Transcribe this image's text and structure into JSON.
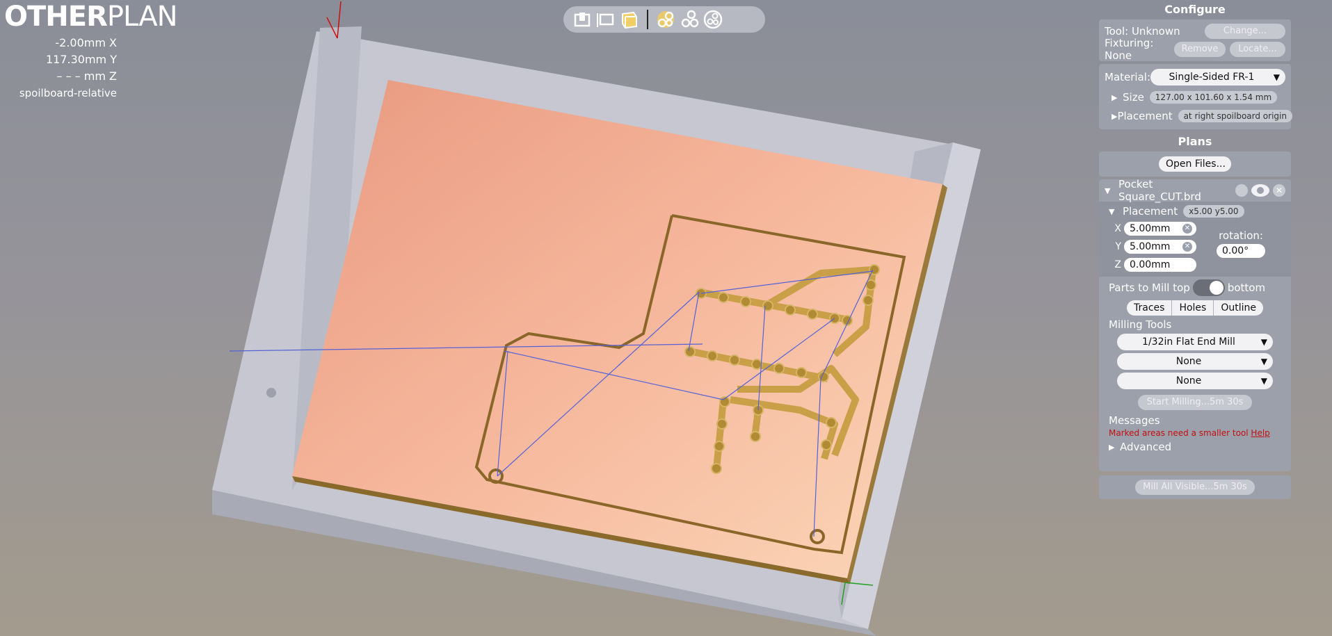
{
  "logo": {
    "part1": "OTHER",
    "part2": "PLAN"
  },
  "coords": {
    "x": "-2.00mm X",
    "y": "117.30mm Y",
    "z": "– – – mm Z",
    "reference": "spoilboard-relative"
  },
  "toolbar": {
    "left_icons": [
      "home-view-icon",
      "top-view-icon",
      "iso-view-icon"
    ],
    "right_icons": [
      "show-traces-icon",
      "show-toolpaths-icon",
      "show-simulation-icon"
    ]
  },
  "configure": {
    "title": "Configure",
    "tool_label": "Tool: Unknown",
    "change_button": "Change...",
    "fixturing_label": "Fixturing: None",
    "remove_button": "Remove",
    "locate_button": "Locate...",
    "material_label": "Material:",
    "material_value": "Single-Sided FR-1",
    "size_label": "Size",
    "size_value": "127.00 x 101.60 x 1.54 mm",
    "placement_label": "Placement",
    "placement_value": "at right spoilboard origin"
  },
  "plans": {
    "title": "Plans",
    "open_files_button": "Open Files...",
    "file_name": "Pocket Square_CUT.brd",
    "placement_label": "Placement",
    "placement_value": "x5.00 y5.00",
    "x_label": "X",
    "x_value": "5.00mm",
    "y_label": "Y",
    "y_value": "5.00mm",
    "z_label": "Z",
    "z_value": "0.00mm",
    "rotation_label": "rotation:",
    "rotation_value": "0.00°",
    "parts_label": "Parts to Mill top",
    "parts_bottom": "bottom",
    "tabs": [
      "Traces",
      "Holes",
      "Outline"
    ],
    "milling_tools_label": "Milling Tools",
    "tool1": "1/32in Flat End Mill",
    "tool2": "None",
    "tool3": "None",
    "start_button": "Start Milling...5m 30s",
    "messages_label": "Messages",
    "message_text": "Marked areas need a smaller tool",
    "message_link": "Help",
    "advanced_label": "Advanced",
    "mill_all_button": "Mill All Visible...5m 30s"
  },
  "colors": {
    "accent_red": "#cc1010",
    "copper": "#f0b090",
    "panel": "#9ca0ab"
  }
}
